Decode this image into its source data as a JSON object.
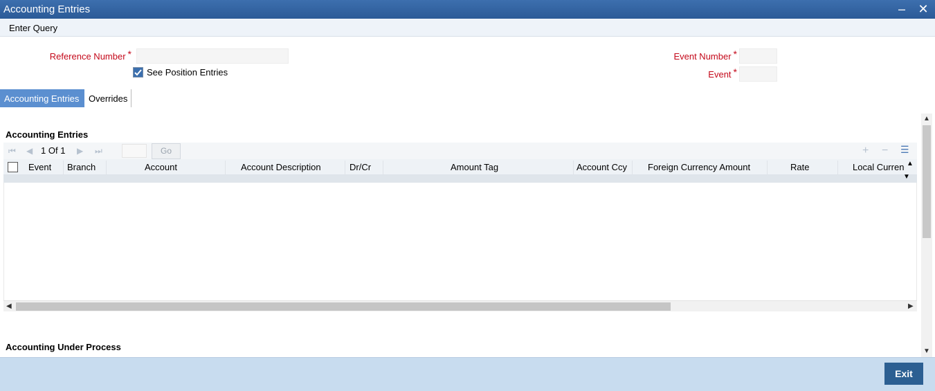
{
  "window": {
    "title": "Accounting Entries"
  },
  "toolbar": {
    "enter_query": "Enter Query"
  },
  "form": {
    "reference_number_label": "Reference Number",
    "reference_number_value": "",
    "required_mark": "*",
    "see_position_entries_label": "See Position Entries",
    "see_position_entries_checked": true,
    "event_number_label": "Event Number",
    "event_number_value": "",
    "event_label": "Event",
    "event_value": ""
  },
  "tabs": [
    {
      "label": "Accounting Entries",
      "active": true
    },
    {
      "label": "Overrides",
      "active": false
    }
  ],
  "accounting_entries": {
    "section_title": "Accounting Entries",
    "pager": {
      "current": "1",
      "of_label": "Of",
      "total": "1",
      "go_label": "Go"
    },
    "columns": [
      "Event",
      "Branch",
      "Account",
      "Account Description",
      "Dr/Cr",
      "Amount Tag",
      "Account Ccy",
      "Foreign Currency Amount",
      "Rate",
      "Local Currency"
    ]
  },
  "accounting_under_process": {
    "section_title": "Accounting Under Process"
  },
  "footer": {
    "exit_label": "Exit"
  },
  "colors": {
    "title_bar": "#2b5a97",
    "active_tab": "#5b8fd0",
    "required": "#c4081a",
    "exit_button": "#2c5f92",
    "footer": "#c8dcef"
  }
}
